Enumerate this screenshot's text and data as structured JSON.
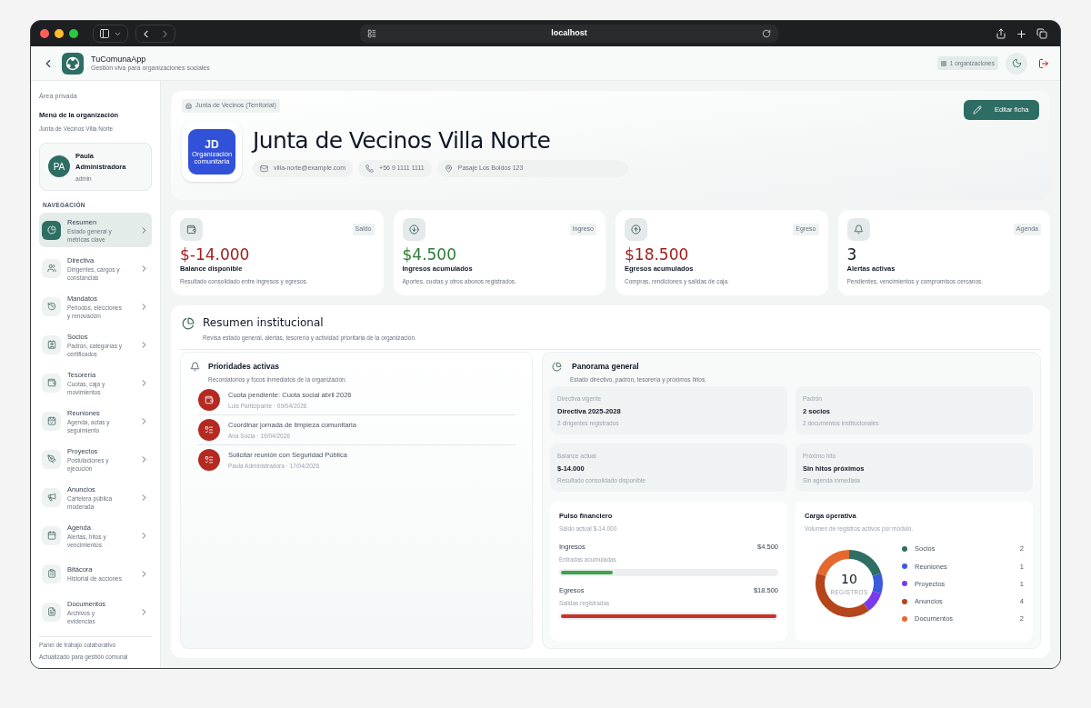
{
  "browser": {
    "url": "localhost"
  },
  "app_header": {
    "name": "TuComunaApp",
    "tagline": "Gestión viva para organizaciones sociales",
    "org_count": "1 organizaciones"
  },
  "sidebar": {
    "section_label": "Área privada",
    "menu_title": "Menú de la organización",
    "org_name": "Junta de Vecinos Villa Norte",
    "user": {
      "initials": "PA",
      "name": "Paula Administradora",
      "role": "admin"
    },
    "nav_heading": "NAVEGACIÓN",
    "items": [
      {
        "kind": "summary",
        "title": "Resumen",
        "subtitle": "Estado general y métricas clave",
        "selected": true
      },
      {
        "kind": "board",
        "title": "Directiva",
        "subtitle": "Dirigentes, cargos y constancias",
        "selected": false
      },
      {
        "kind": "terms",
        "title": "Mandatos",
        "subtitle": "Periodos, elecciones y renovación",
        "selected": false
      },
      {
        "kind": "members",
        "title": "Socios",
        "subtitle": "Padrón, categorías y certificados",
        "selected": false
      },
      {
        "kind": "treasury",
        "title": "Tesorería",
        "subtitle": "Cuotas, caja y movimientos",
        "selected": false
      },
      {
        "kind": "meetings",
        "title": "Reuniones",
        "subtitle": "Agenda, actas y seguimiento",
        "selected": false
      },
      {
        "kind": "projects",
        "title": "Proyectos",
        "subtitle": "Postulaciones y ejecución",
        "selected": false
      },
      {
        "kind": "notices",
        "title": "Anuncios",
        "subtitle": "Cartelera pública moderada",
        "selected": false
      },
      {
        "kind": "agenda",
        "title": "Agenda",
        "subtitle": "Alertas, hitos y vencimientos",
        "selected": false
      },
      {
        "kind": "log",
        "title": "Bitácora",
        "subtitle": "Historial de acciones",
        "selected": false
      },
      {
        "kind": "documents",
        "title": "Documentos",
        "subtitle": "Archivos y evidencias",
        "selected": false
      }
    ],
    "footer": [
      "Panel de trabajo colaborativo",
      "Actualizado para gestión comunal"
    ]
  },
  "hero": {
    "tag": "Junta de Vecinos (Territorial)",
    "initials": "JD",
    "logo_caption": "Organización comunitaria",
    "title": "Junta de Vecinos Villa Norte",
    "contacts": [
      {
        "kind": "email",
        "text": "villa-norte@example.com"
      },
      {
        "kind": "phone",
        "text": "+56 9 1111 1111"
      },
      {
        "kind": "address",
        "text": "Pasaje Los Boldos 123"
      }
    ],
    "edit_button": "Editar ficha"
  },
  "stats": [
    {
      "kind": "wallet",
      "badge": "Saldo",
      "value": "$-14.000",
      "color": "#a11d1d",
      "label": "Balance disponible",
      "description": "Resultado consolidado entre ingresos y egresos."
    },
    {
      "kind": "income",
      "badge": "Ingreso",
      "value": "$4.500",
      "color": "#2b7a35",
      "label": "Ingresos acumulados",
      "description": "Aportes, cuotas y otros abonos registrados."
    },
    {
      "kind": "expense",
      "badge": "Egreso",
      "value": "$18.500",
      "color": "#a11d1d",
      "label": "Egresos acumulados",
      "description": "Compras, rendiciones y salidas de caja."
    },
    {
      "kind": "alerts",
      "badge": "Agenda",
      "value": "3",
      "color": "#111827",
      "label": "Alertas activas",
      "description": "Pendientes, vencimientos y compromisos cercanos."
    }
  ],
  "summary": {
    "title": "Resumen institucional",
    "subtitle": "Revisa estado general, alertas, tesorería y actividad prioritaria de la organización.",
    "priorities": {
      "title": "Prioridades activas",
      "subtitle": "Recordatorios y focos inmediatos de la organización.",
      "items": [
        {
          "kind": "payment",
          "title": "Cuota pendiente: Cuota social abril 2026",
          "meta": "Luis Participante · 09/04/2026"
        },
        {
          "kind": "task",
          "title": "Coordinar jornada de limpieza comunitaria",
          "meta": "Ana Socia · 19/04/2026"
        },
        {
          "kind": "task",
          "title": "Solicitar reunión con Seguridad Pública",
          "meta": "Paula Administradora · 17/04/2026"
        }
      ]
    },
    "overview": {
      "title": "Panorama general",
      "subtitle": "Estado directivo, padrón, tesorería y próximos hitos.",
      "tiles": [
        {
          "label": "Directiva vigente",
          "value": "Directiva 2025-2028",
          "note": "2 dirigentes registrados"
        },
        {
          "label": "Padrón",
          "value": "2 socios",
          "note": "2 documentos institucionales"
        },
        {
          "label": "Balance actual",
          "value": "$-14.000",
          "note": "Resultado consolidado disponible"
        },
        {
          "label": "Próximo hito",
          "value": "Sin hitos próximos",
          "note": "Sin agenda inmediata"
        }
      ],
      "pulse": {
        "title": "Pulso financiero",
        "subtitle": "Saldo actual $-14.000",
        "rows": [
          {
            "label": "Ingresos",
            "amount": "$4.500",
            "note": "Entradas acumuladas",
            "level": 0.24,
            "color": "#3fa34d"
          },
          {
            "label": "Egresos",
            "amount": "$18.500",
            "note": "Salidas registradas",
            "level": 1,
            "color": "#c8322b"
          }
        ]
      },
      "load": {
        "title": "Carga operativa",
        "subtitle": "Volumen de registros activos por módulo.",
        "total": "10",
        "total_label": "REGISTROS",
        "legend": [
          {
            "label": "Socios",
            "count": "2",
            "color": "#2f6f63"
          },
          {
            "label": "Reuniones",
            "count": "1",
            "color": "#3b5bdb"
          },
          {
            "label": "Proyectos",
            "count": "1",
            "color": "#7c3aed"
          },
          {
            "label": "Anuncios",
            "count": "4",
            "color": "#b5451b"
          },
          {
            "label": "Documentos",
            "count": "2",
            "color": "#e5692e"
          }
        ],
        "chart_data": {
          "type": "donut",
          "values": [
            20,
            10,
            10,
            40,
            20
          ]
        }
      }
    }
  }
}
